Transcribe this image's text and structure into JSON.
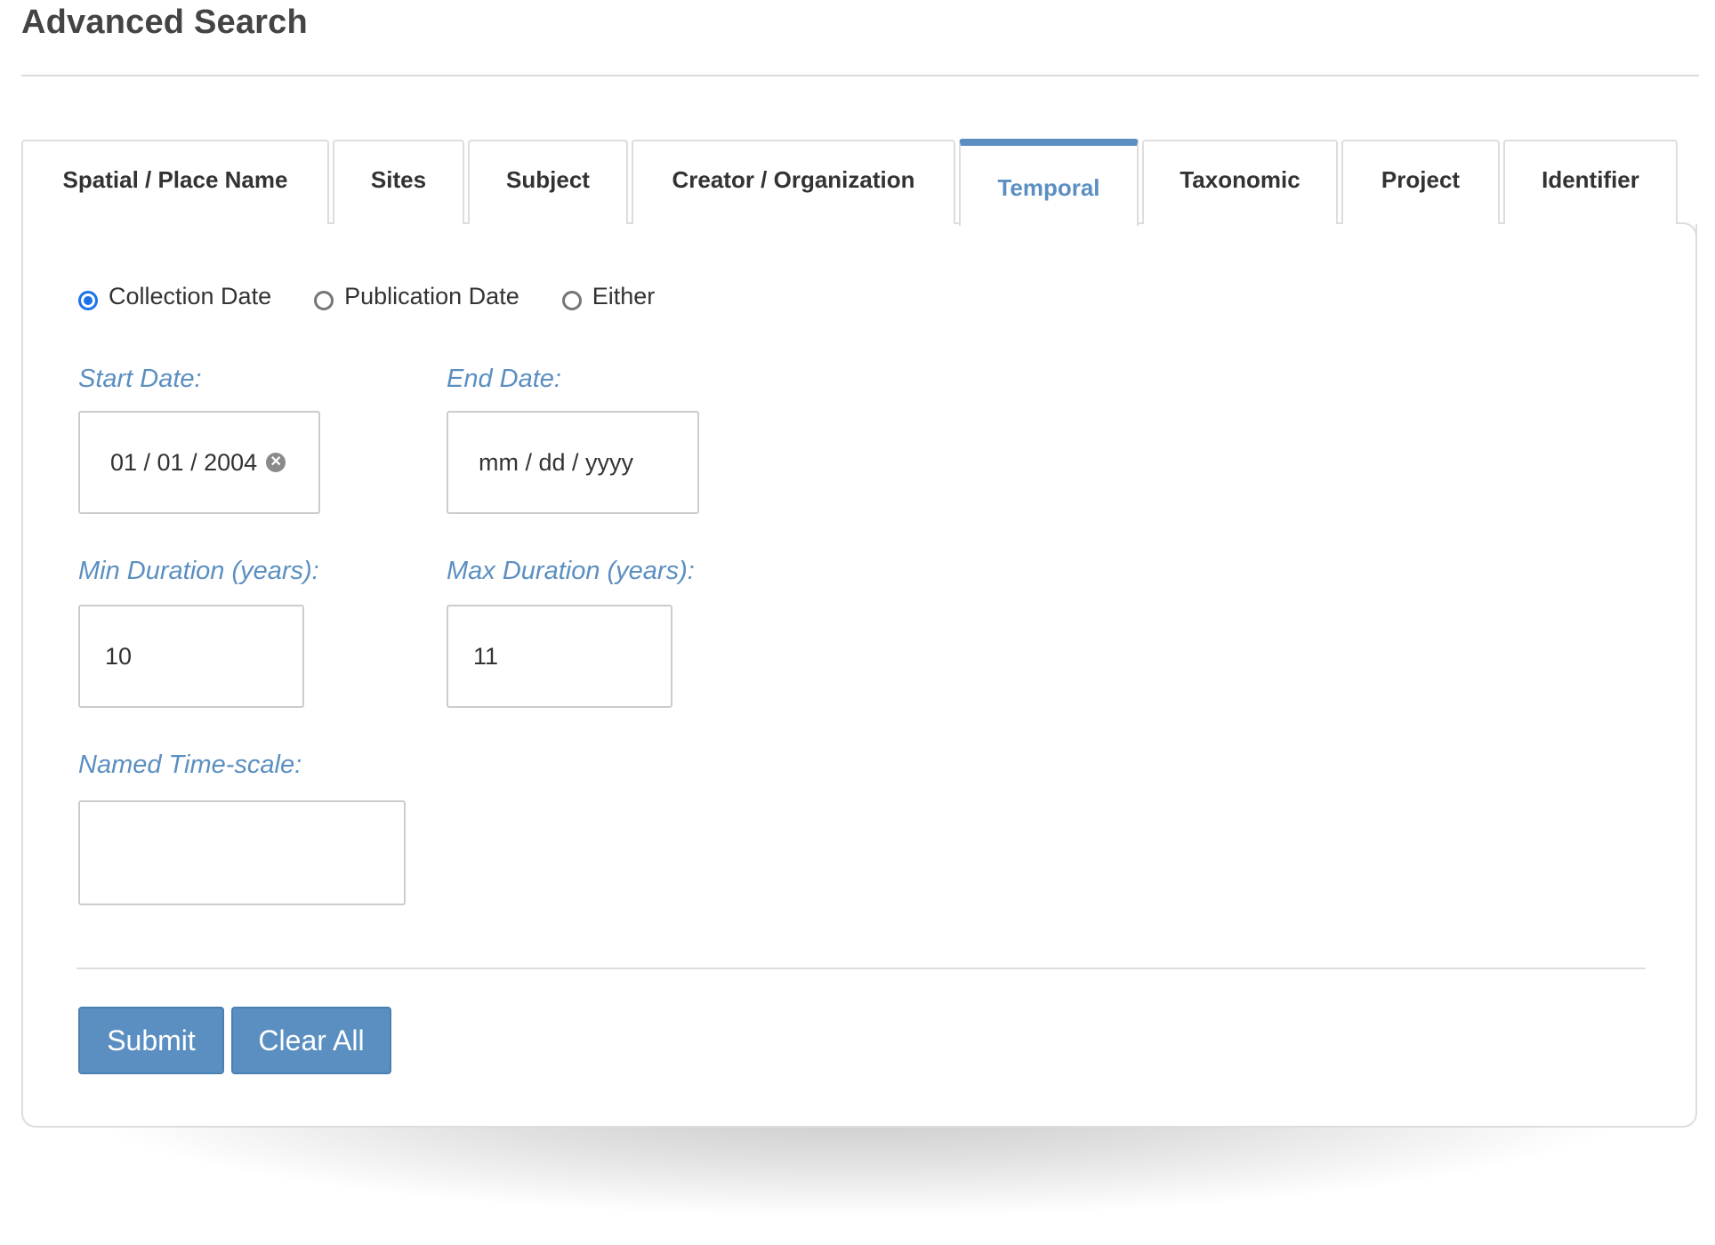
{
  "page": {
    "title": "Advanced Search"
  },
  "tabs": [
    {
      "label": "Spatial / Place Name",
      "active": false
    },
    {
      "label": "Sites",
      "active": false
    },
    {
      "label": "Subject",
      "active": false
    },
    {
      "label": "Creator / Organization",
      "active": false
    },
    {
      "label": "Temporal",
      "active": true
    },
    {
      "label": "Taxonomic",
      "active": false
    },
    {
      "label": "Project",
      "active": false
    },
    {
      "label": "Identifier",
      "active": false
    }
  ],
  "temporal": {
    "date_type": {
      "options": [
        "Collection Date",
        "Publication Date",
        "Either"
      ],
      "selected": "Collection Date"
    },
    "start_date": {
      "label": "Start Date:",
      "value": "01 / 01 / 2004"
    },
    "end_date": {
      "label": "End Date:",
      "placeholder": "mm / dd / yyyy"
    },
    "min_duration": {
      "label": "Min Duration (years):",
      "value": "10"
    },
    "max_duration": {
      "label": "Max Duration (years):",
      "value": "11"
    },
    "named_timescale": {
      "label": "Named Time-scale:",
      "value": ""
    }
  },
  "actions": {
    "submit_label": "Submit",
    "clear_label": "Clear All"
  },
  "icons": {
    "clear_date": "clear-circle-icon"
  },
  "colors": {
    "accent": "#5b8fc1",
    "radio_checked": "#1a73e8",
    "border": "#dddddd"
  }
}
